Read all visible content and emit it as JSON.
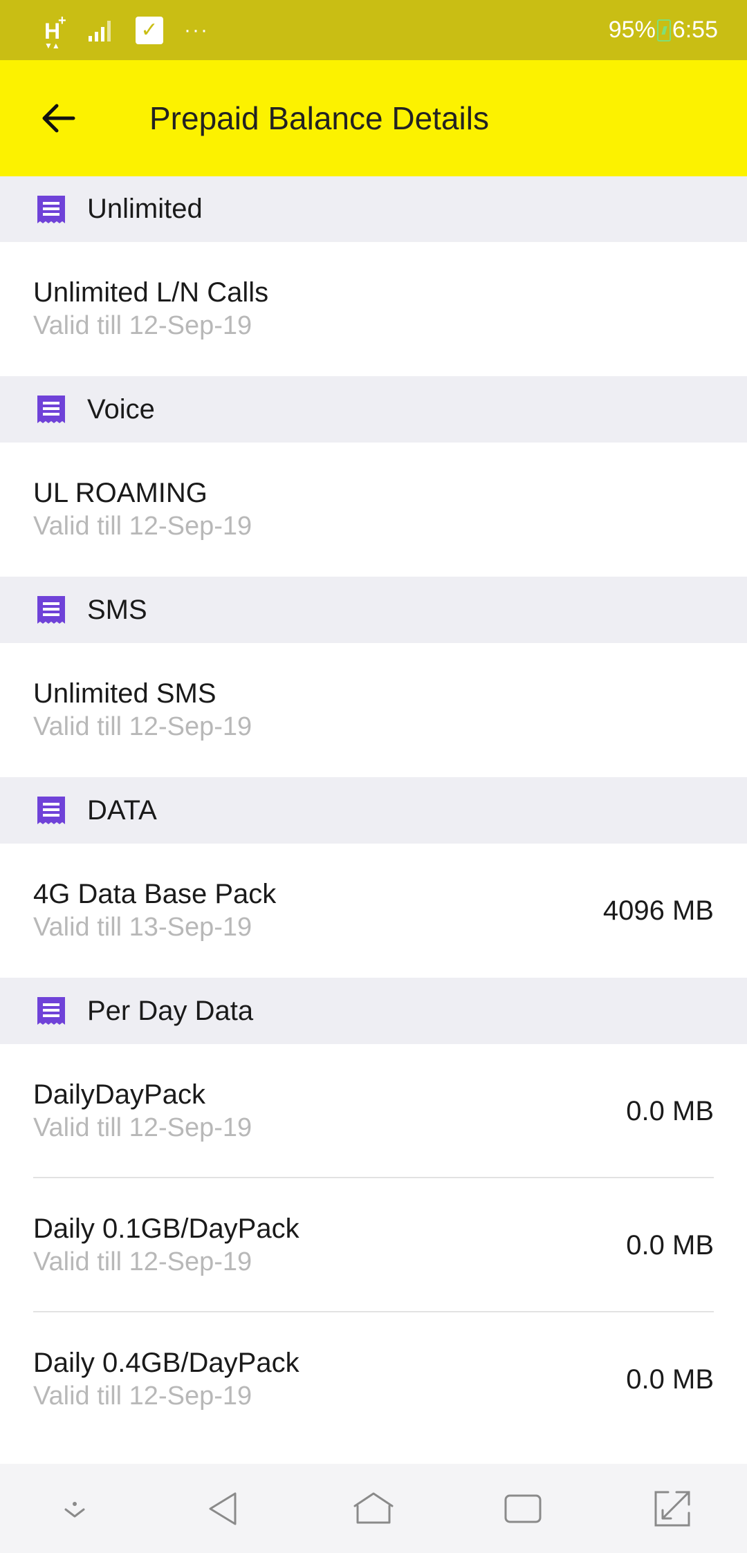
{
  "status_bar": {
    "network": "H",
    "battery": "95%",
    "time": "6:55",
    "overflow": "···"
  },
  "app_bar": {
    "title": "Prepaid Balance Details"
  },
  "sections": [
    {
      "title": "Unlimited",
      "items": [
        {
          "name": "Unlimited L/N Calls",
          "valid": "Valid till 12-Sep-19",
          "amount": ""
        }
      ]
    },
    {
      "title": "Voice",
      "items": [
        {
          "name": "UL ROAMING",
          "valid": "Valid till 12-Sep-19",
          "amount": ""
        }
      ]
    },
    {
      "title": "SMS",
      "items": [
        {
          "name": "Unlimited SMS",
          "valid": "Valid till 12-Sep-19",
          "amount": ""
        }
      ]
    },
    {
      "title": "DATA",
      "items": [
        {
          "name": "4G Data Base Pack",
          "valid": "Valid till 13-Sep-19",
          "amount": "4096 MB"
        }
      ]
    },
    {
      "title": "Per Day Data",
      "items": [
        {
          "name": "DailyDayPack",
          "valid": "Valid till 12-Sep-19",
          "amount": "0.0 MB"
        },
        {
          "name": "Daily 0.1GB/DayPack",
          "valid": "Valid till 12-Sep-19",
          "amount": "0.0 MB"
        },
        {
          "name": "Daily 0.4GB/DayPack",
          "valid": "Valid till 12-Sep-19",
          "amount": "0.0 MB"
        }
      ]
    }
  ],
  "colors": {
    "status_bar": "#c9be14",
    "app_bar": "#fcf200",
    "section_bg": "#eeeef3",
    "icon_purple": "#6f42d8",
    "muted_text": "#b8b8b8"
  },
  "icons": {
    "section": "receipt-icon",
    "back": "arrow-left-icon",
    "nav": [
      "chevron-down-icon",
      "back-triangle-icon",
      "home-icon",
      "recents-icon",
      "expand-icon"
    ]
  }
}
